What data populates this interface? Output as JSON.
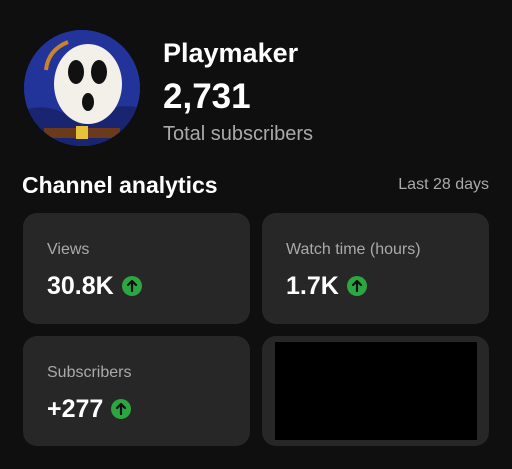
{
  "channel": {
    "name": "Playmaker",
    "subscriber_count": "2,731",
    "subscriber_label": "Total subscribers",
    "avatar_icon": "shy-guy-avatar"
  },
  "analytics": {
    "title": "Channel analytics",
    "period": "Last 28 days",
    "cards": [
      {
        "label": "Views",
        "value": "30.8K",
        "trend_icon": "arrow-up-circle-icon"
      },
      {
        "label": "Watch time (hours)",
        "value": "1.7K",
        "trend_icon": "arrow-up-circle-icon"
      },
      {
        "label": "Subscribers",
        "value": "+277",
        "trend_icon": "arrow-up-circle-icon"
      }
    ]
  },
  "colors": {
    "background": "#0f0f0f",
    "card": "#272727",
    "trend_up": "#2ba640",
    "secondary_text": "#aaaaaa"
  }
}
